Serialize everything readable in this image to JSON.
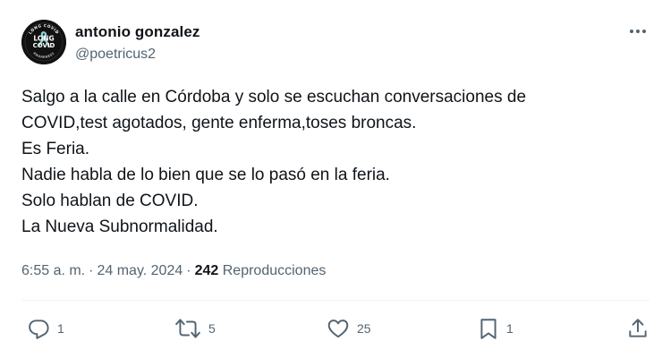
{
  "author": {
    "name": "antonio gonzalez",
    "handle": "@poetricus2",
    "avatar": {
      "top_text": "LONG COVID",
      "badge_line1": "LONG",
      "badge_line2": "COVID",
      "bottom_text": "AWARENESS"
    }
  },
  "tweet": {
    "lines": [
      "Salgo a la calle en Córdoba y solo se escuchan conversaciones de",
      "COVID,test agotados, gente enferma,toses broncas.",
      "Es Feria.",
      "Nadie habla de lo bien que se lo pasó en la feria.",
      "Solo hablan de COVID.",
      "La Nueva Subnormalidad."
    ]
  },
  "meta": {
    "time": "6:55 a. m.",
    "separator": "·",
    "date": "24 may. 2024",
    "views_count": "242",
    "views_label": "Reproducciones"
  },
  "actions": {
    "replies": "1",
    "retweets": "5",
    "likes": "25",
    "bookmarks": "1"
  },
  "icons": {
    "more": "more-horizontal-icon",
    "reply": "reply-icon",
    "retweet": "retweet-icon",
    "like": "heart-icon",
    "bookmark": "bookmark-icon",
    "share": "share-icon"
  },
  "colors": {
    "text": "#0f1419",
    "secondary": "#536471",
    "divider": "#eff3f4",
    "ribbon": "#8fd0d8"
  }
}
